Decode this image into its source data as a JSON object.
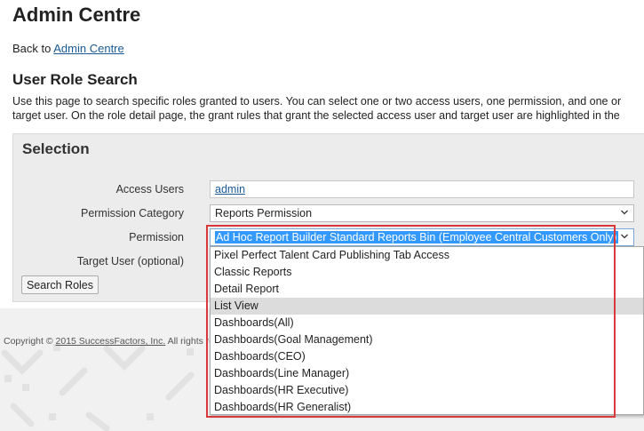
{
  "page": {
    "title": "Admin Centre",
    "back_prefix": "Back to",
    "back_link": "Admin Centre",
    "section_title": "User Role Search",
    "description_line1": "Use this page to search specific roles granted to users. You can select one or two access users, one permission, and one or",
    "description_line2": "target user. On the role detail page, the grant rules that grant the selected access user and target user are highlighted in the"
  },
  "selection": {
    "title": "Selection",
    "access_users_label": "Access Users",
    "access_users_value": "admin",
    "permission_category_label": "Permission Category",
    "permission_category_value": "Reports Permission",
    "permission_label": "Permission",
    "permission_value": "Ad Hoc Report Builder Standard Reports Bin (Employee Central Customers Only)",
    "target_user_label": "Target User (optional)",
    "search_button": "Search Roles"
  },
  "permission_options": [
    "Pixel Perfect Talent Card Publishing Tab Access",
    "Classic Reports",
    "Detail Report",
    "List View",
    "Dashboards(All)",
    "Dashboards(Goal Management)",
    "Dashboards(CEO)",
    "Dashboards(Line Manager)",
    "Dashboards(HR Executive)",
    "Dashboards(HR Generalist)"
  ],
  "hovered_option": "List View",
  "footer": {
    "copyright_prefix": "Copyright ©",
    "copyright_link": "2015 SuccessFactors, Inc.",
    "copyright_suffix": "All rights res"
  },
  "colors": {
    "link": "#1a5a96",
    "selection_highlight": "#3399ff",
    "annotation_border": "#d9393b",
    "panel_bg": "#ececec"
  },
  "icons": {
    "select_arrow": "chevron-down-icon"
  }
}
